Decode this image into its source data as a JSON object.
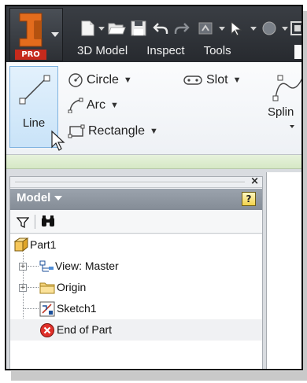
{
  "app": {
    "edition_badge": "PRO",
    "logo_letter": "I"
  },
  "ribbon_tabs": [
    "3D Model",
    "Inspect",
    "Tools"
  ],
  "ribbon": {
    "line_label": "Line",
    "circle_label": "Circle",
    "arc_label": "Arc",
    "rectangle_label": "Rectangle",
    "slot_label": "Slot",
    "spline_label": "Splin"
  },
  "browser": {
    "close_label": "×",
    "title": "Model",
    "help_label": "?",
    "tree": [
      {
        "label": "Part1",
        "icon": "part-icon",
        "level": 0
      },
      {
        "label": "View: Master",
        "icon": "view-rep-icon",
        "level": 1
      },
      {
        "label": "Origin",
        "icon": "folder-icon",
        "level": 1
      },
      {
        "label": "Sketch1",
        "icon": "sketch-icon",
        "level": 1
      },
      {
        "label": "End of Part",
        "icon": "end-of-part-icon",
        "level": 1
      }
    ]
  },
  "colors": {
    "titlebar": "#2f3237",
    "inventor_orange": "#e36c1d",
    "pro_red": "#c62a1c",
    "ribbon_highlight": "#c9e3f8",
    "browser_header": "#8e96a0"
  }
}
